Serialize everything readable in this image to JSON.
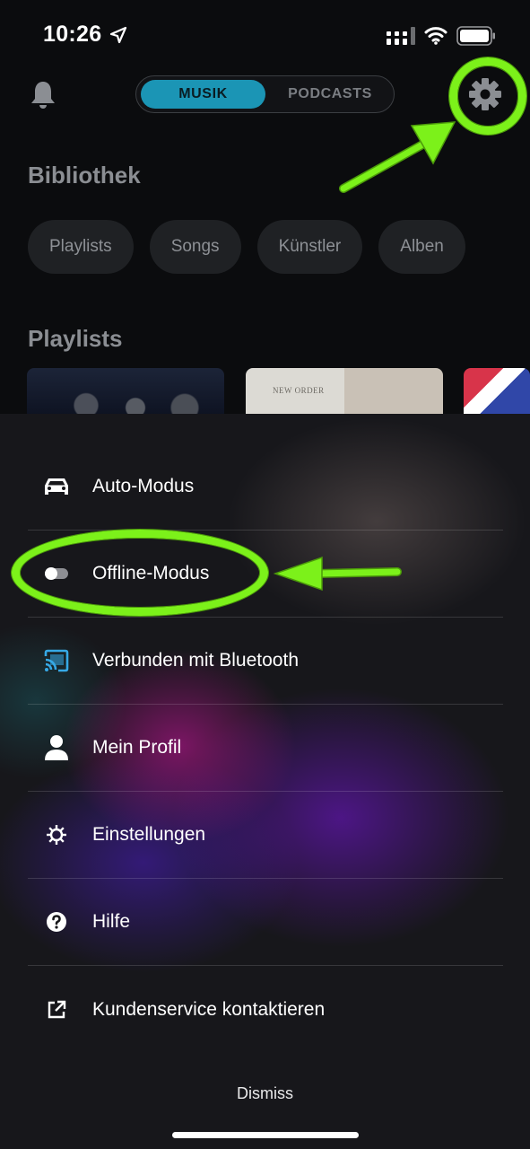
{
  "status_bar": {
    "time": "10:26",
    "icons": [
      "location-arrow-icon",
      "signal-icon",
      "wifi-icon",
      "battery-icon"
    ]
  },
  "header": {
    "bell_icon": "bell-icon",
    "tabs": [
      {
        "label": "MUSIK",
        "active": true
      },
      {
        "label": "PODCASTS",
        "active": false
      }
    ],
    "settings_icon": "gear-icon"
  },
  "library": {
    "title": "Bibliothek",
    "chips": [
      "Playlists",
      "Songs",
      "Künstler",
      "Alben"
    ]
  },
  "playlists": {
    "title": "Playlists",
    "album_text": "NEW ORDER"
  },
  "sheet": {
    "items": [
      {
        "label": "Auto-Modus",
        "icon": "car-icon"
      },
      {
        "label": "Offline-Modus",
        "icon": "toggle-icon"
      },
      {
        "label": "Verbunden mit Bluetooth",
        "icon": "cast-icon"
      },
      {
        "label": "Mein Profil",
        "icon": "person-icon"
      },
      {
        "label": "Einstellungen",
        "icon": "gear-icon"
      },
      {
        "label": "Hilfe",
        "icon": "help-icon"
      },
      {
        "label": "Kundenservice kontaktieren",
        "icon": "external-link-icon"
      }
    ],
    "dismiss_label": "Dismiss"
  },
  "colors": {
    "accent": "#1b95b5",
    "highlight": "#7cf11a",
    "background": "#0b0c0e",
    "cast_icon": "#36a9e6"
  }
}
